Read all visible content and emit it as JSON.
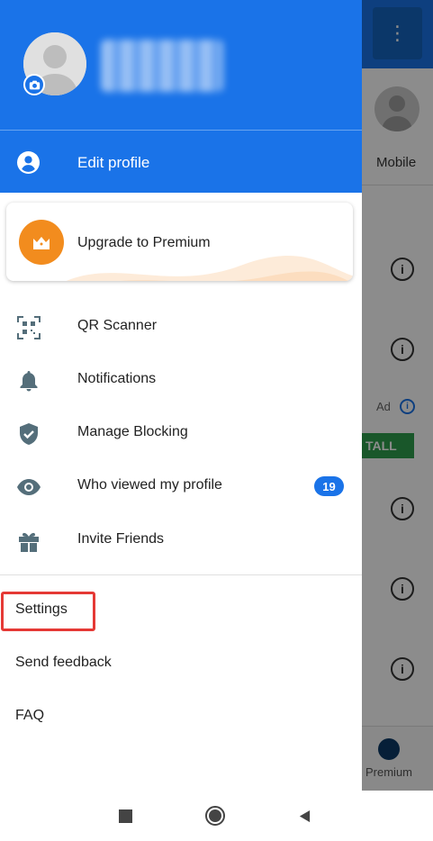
{
  "background_app": {
    "tab_label": "Mobile",
    "ad_label": "Ad",
    "install_label": "TALL",
    "premium_tab_label": "Premium"
  },
  "drawer": {
    "edit_profile_label": "Edit profile",
    "premium_label": "Upgrade to Premium",
    "menu_items": [
      {
        "label": "QR Scanner",
        "icon": "qr-scanner-icon"
      },
      {
        "label": "Notifications",
        "icon": "bell-icon"
      },
      {
        "label": "Manage Blocking",
        "icon": "shield-icon"
      },
      {
        "label": "Who viewed my profile",
        "icon": "eye-icon",
        "badge": "19"
      },
      {
        "label": "Invite Friends",
        "icon": "gift-icon"
      }
    ],
    "text_items": [
      {
        "label": "Settings"
      },
      {
        "label": "Send feedback"
      },
      {
        "label": "FAQ"
      }
    ]
  },
  "colors": {
    "primary_blue": "#1a73e8",
    "premium_orange": "#f28c1e",
    "highlight_red": "#e53935"
  },
  "navbar": {
    "buttons": [
      "recent-apps",
      "home",
      "back"
    ]
  }
}
